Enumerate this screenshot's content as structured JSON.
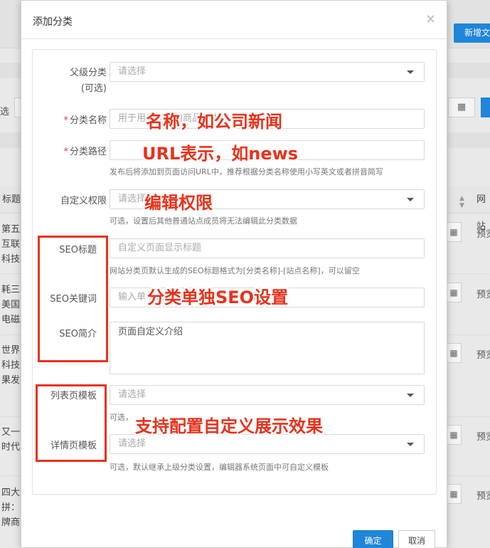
{
  "background": {
    "new_button": "新增文",
    "filter_label": "选",
    "date_icon": "calendar-icon",
    "table_header_left": "标题",
    "table_header_right": "网站",
    "rows": [
      {
        "lines": [
          "第五届",
          "互联网",
          "科技节"
        ],
        "preview": "预览"
      },
      {
        "lines": [
          "耗三年",
          "美国N",
          "电磁驱"
        ],
        "preview": "预览"
      },
      {
        "lines": [
          "世界首",
          "科技最",
          "果发布"
        ],
        "preview": "预览"
      },
      {
        "lines": [
          "又一个",
          "时代"
        ],
        "preview": "预览"
      },
      {
        "lines": [
          "四大",
          "拼：",
          "牌商"
        ],
        "preview": "预览"
      }
    ]
  },
  "modal": {
    "title": "添加分类",
    "close_icon": "close-icon",
    "fields": {
      "parent": {
        "label": "父级分类",
        "sublabel": "(可选)",
        "placeholder": "请选择"
      },
      "name": {
        "label": "分类名称",
        "required": true,
        "placeholder": "用于用户显示的商品分类名"
      },
      "path": {
        "label": "分类路径",
        "required": true,
        "placeholder": "",
        "hint": "发布后将添加到页面访问URL中，推荐根据分类名称使用小写英文或者拼音简写"
      },
      "permission": {
        "label": "自定义权限",
        "placeholder": "请选择",
        "hint": "可选，设置后其他普通站点成员将无法编辑此分类数据"
      },
      "seo_title": {
        "label": "SEO标题",
        "placeholder": "自定义页面显示标题",
        "hint": "网站分类页默认生成的SEO标题格式为[分类名称]-[站点名称]，可以留空"
      },
      "seo_keywords": {
        "label": "SEO关键词",
        "placeholder": "输入单个关键词后按回车，如：百度"
      },
      "seo_description": {
        "label": "SEO简介",
        "value": "页面自定义介绍"
      },
      "list_template": {
        "label": "列表页模板",
        "placeholder": "请选择",
        "hint": "可选，"
      },
      "detail_template": {
        "label": "详情页模板",
        "placeholder": "请选择",
        "hint": "可选，默认继承上级分类设置，编辑器系统页面中可自定义模板"
      }
    },
    "ok_label": "确定",
    "cancel_label": "取消"
  },
  "annotations": {
    "name": "名称，如公司新闻",
    "path": "URL表示，如news",
    "permission": "编辑权限",
    "seo": "分类单独SEO设置",
    "template": "支持配置自定义展示效果"
  },
  "colors": {
    "primary": "#1f86d9",
    "annotation": "#e8321b",
    "required": "#ee3333"
  }
}
